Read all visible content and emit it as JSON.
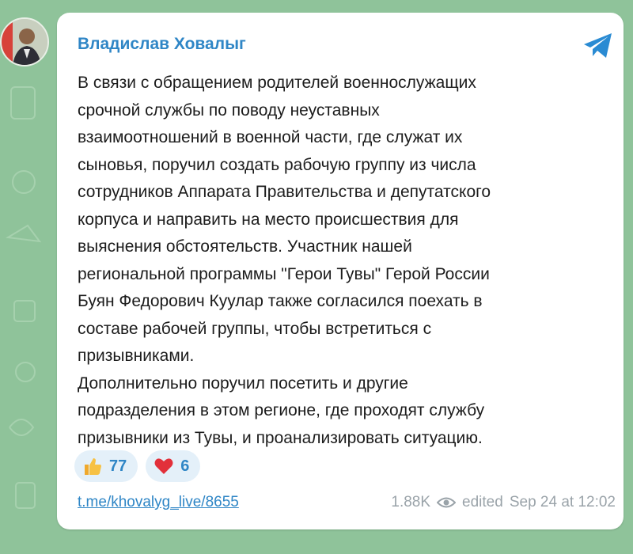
{
  "channel": {
    "author": "Владислав Ховалыг"
  },
  "message": {
    "text": "В связи с обращением родителей военнослужащих\nсрочной службы по поводу неуставных\nвзаимоотношений в военной части, где служат их\nсыновья, поручил создать рабочую группу из числа\nсотрудников Аппарата Правительства и депутатского\nкорпуса  и направить на место происшествия для\nвыяснения обстоятельств. Участник нашей\nрегиональной программы \"Герои Тувы\" Герой России\nБуян Федорович Куулар также согласился поехать в\nсоставе рабочей группы, чтобы встретиться с\nпризывниками.\nДополнительно поручил посетить и другие\nподразделения в этом регионе, где проходят службу\nпризывники из Тувы, и проанализировать ситуацию.",
    "link": "t.me/khovalyg_live/8655",
    "views": "1.88K",
    "status": "edited",
    "timestamp": "Sep 24 at 12:02"
  },
  "reactions": [
    {
      "icon": "thumbs-up-icon",
      "count": "77"
    },
    {
      "icon": "heart-icon",
      "count": "6"
    }
  ],
  "colors": {
    "background": "#8fc39a",
    "accent": "#2f86c6",
    "reaction_bg": "#e4f0f9",
    "meta": "#9aa3a9"
  }
}
